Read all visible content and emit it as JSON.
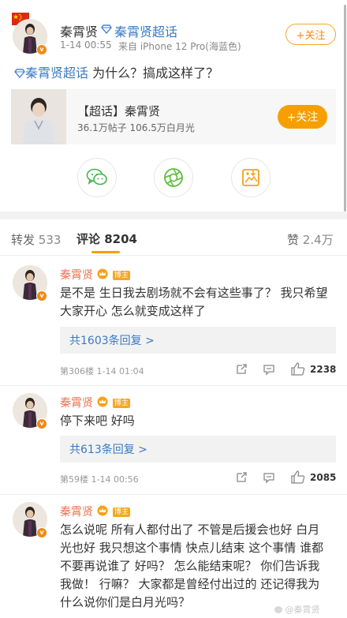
{
  "post": {
    "author": "秦霄贤",
    "topic_link": "秦霄贤超话",
    "time": "1-14 00:55",
    "source": "来自 iPhone 12 Pro(海蓝色)",
    "follow_label": "+关注",
    "body_topic": "秦霄贤超话",
    "body_text": " 为什么？搞成这样了？"
  },
  "supertopic_card": {
    "title": "【超话】秦霄贤",
    "stats": "36.1万帖子 106.5万白月光",
    "follow_label": "+关注"
  },
  "share": {
    "icons": [
      "wechat-icon",
      "moments-icon",
      "save-image-icon"
    ]
  },
  "tabs": {
    "repost_label": "转发",
    "repost_count": "533",
    "comment_label": "评论",
    "comment_count": "8204",
    "like_label": "赞",
    "like_count": "2.4万"
  },
  "comments": [
    {
      "author": "秦霄贤",
      "badge": "博主",
      "text": "是不是 生日我去剧场就不会有这些事了？  我只希望大家开心   怎么就变成这样了",
      "replies": "共1603条回复 >",
      "floor": "第306楼  1-14 01:04",
      "likes": "2238"
    },
    {
      "author": "秦霄贤",
      "badge": "博主",
      "text": "停下来吧  好吗",
      "replies": "共613条回复 >",
      "floor": "第59楼  1-14 00:56",
      "likes": "2085"
    },
    {
      "author": "秦霄贤",
      "badge": "博主",
      "text": "怎么说呢  所有人都付出了  不管是后援会也好  白月光也好  我只想这个事情    快点儿结束    这个事情   谁都不要再说谁了  好吗？  怎么能结束呢？  你们告诉我   我做！  行嘛？   大家都是曾经付出过的   还记得我为什么说你们是白月光吗？"
    }
  ],
  "watermark": "@秦霄贤"
}
